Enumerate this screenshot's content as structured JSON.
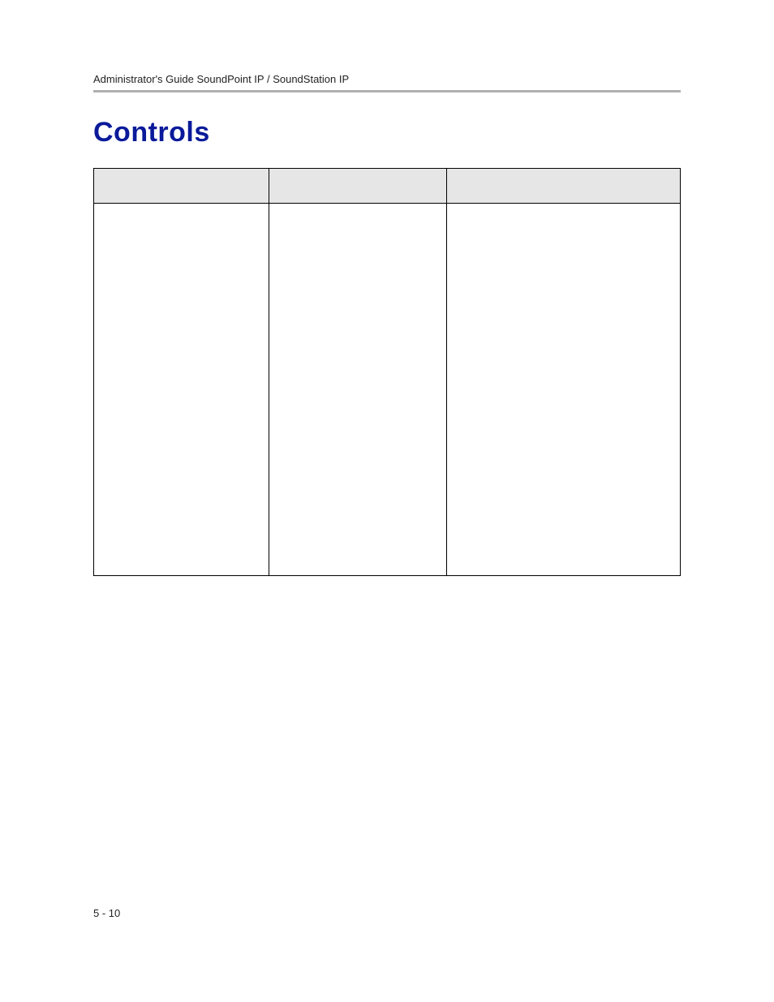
{
  "header": {
    "running_head": "Administrator's Guide SoundPoint IP / SoundStation IP"
  },
  "section": {
    "title": "Controls"
  },
  "table": {
    "headers": [
      "",
      "",
      ""
    ],
    "rows": [
      [
        "",
        "",
        ""
      ]
    ]
  },
  "footer": {
    "page_number": "5 - 10"
  }
}
